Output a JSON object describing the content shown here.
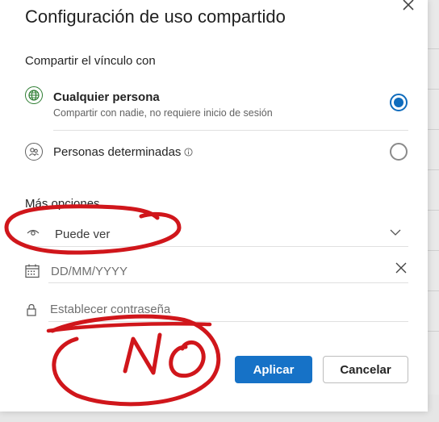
{
  "dialog": {
    "title": "Configuración de uso compartido",
    "share_label": "Compartir el vínculo con"
  },
  "options": [
    {
      "title": "Cualquier persona",
      "subtitle": "Compartir con nadie, no requiere inicio de sesión",
      "icon": "globe-icon",
      "selected": true
    },
    {
      "title": "Personas determinadas",
      "icon": "people-icon",
      "selected": false
    }
  ],
  "more": {
    "label": "Más opciones",
    "permission_value": "Puede ver",
    "date_placeholder": "DD/MM/YYYY",
    "password_placeholder": "Establecer contraseña"
  },
  "buttons": {
    "apply": "Aplicar",
    "cancel": "Cancelar"
  },
  "annotation": {
    "handwritten_text": "NO",
    "color": "#d0161b"
  },
  "colors": {
    "accent": "#0f6cbd",
    "apply_bg": "#1672c7"
  }
}
